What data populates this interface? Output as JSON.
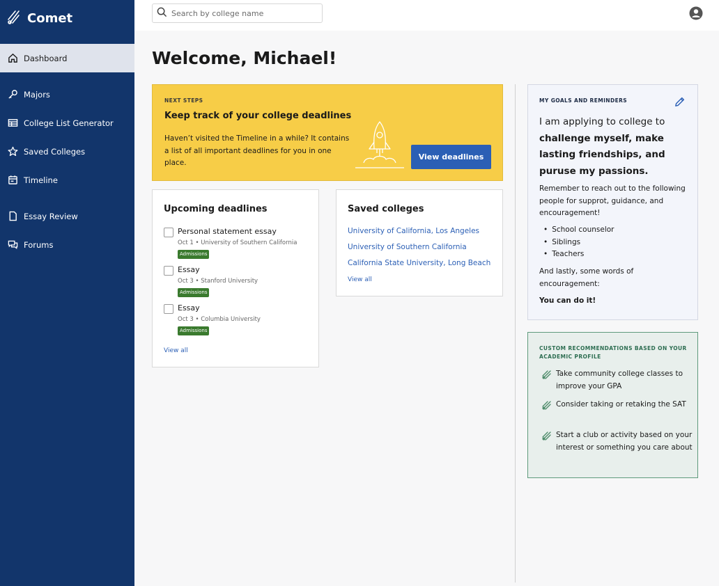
{
  "brand": {
    "name": "Comet"
  },
  "sidebar": {
    "items": [
      {
        "label": "Dashboard",
        "icon": "home-icon",
        "active": true
      },
      {
        "label": "Majors",
        "icon": "key-icon"
      },
      {
        "label": "College List Generator",
        "icon": "table-icon"
      },
      {
        "label": "Saved Colleges",
        "icon": "star-icon"
      },
      {
        "label": "Timeline",
        "icon": "calendar-icon"
      },
      {
        "label": "Essay Review",
        "icon": "document-icon"
      },
      {
        "label": "Forums",
        "icon": "chat-icon"
      }
    ]
  },
  "search": {
    "placeholder": "Search by college name",
    "value": ""
  },
  "header": {
    "title": "Welcome, Michael!"
  },
  "next_steps": {
    "eyebrow": "NEXT STEPS",
    "title": "Keep track of your college deadlines",
    "body": "Haven’t visited the Timeline in a while? It contains a list of all important deadlines for you in one place.",
    "button": "View deadlines"
  },
  "deadlines": {
    "title": "Upcoming deadlines",
    "items": [
      {
        "name": "Personal statement essay",
        "meta": "Oct 1 • University of Southern California",
        "tag": "Admissions"
      },
      {
        "name": "Essay",
        "meta": "Oct 3 • Stanford University",
        "tag": "Admissions"
      },
      {
        "name": "Essay",
        "meta": "Oct 3 • Columbia University",
        "tag": "Admissions"
      }
    ],
    "view_all": "View all"
  },
  "saved": {
    "title": "Saved colleges",
    "colleges": [
      "University of California, Los Angeles",
      "University of Southern California",
      "California State University, Long Beach"
    ],
    "view_all": "View all"
  },
  "goals": {
    "eyebrow": "MY GOALS AND REMINDERS",
    "lead_plain": "I am applying to college to ",
    "lead_bold": "challenge myself, make lasting friendships, and puruse my passions.",
    "reminder": "Remember to reach out to the following people for supprot, guidance, and encouragement!",
    "people": [
      "School counselor",
      "Siblings",
      "Teachers"
    ],
    "encouragement_intro": "And lastly, some words of encouragement:",
    "closing": "You can do it!"
  },
  "recs": {
    "eyebrow": "CUSTOM RECOMMENDATIONS BASED ON YOUR ACADEMIC PROFILE",
    "items": [
      "Take community college classes to improve your GPA",
      "Consider taking or retaking the SAT",
      "Start a club or activity based on your interest or something you care about"
    ]
  },
  "colors": {
    "sidebar": "#12356b",
    "accent": "#2b5fb5",
    "banner": "#f7cd47",
    "tag": "#3a7a2e",
    "recs_border": "#5e9a7c"
  }
}
